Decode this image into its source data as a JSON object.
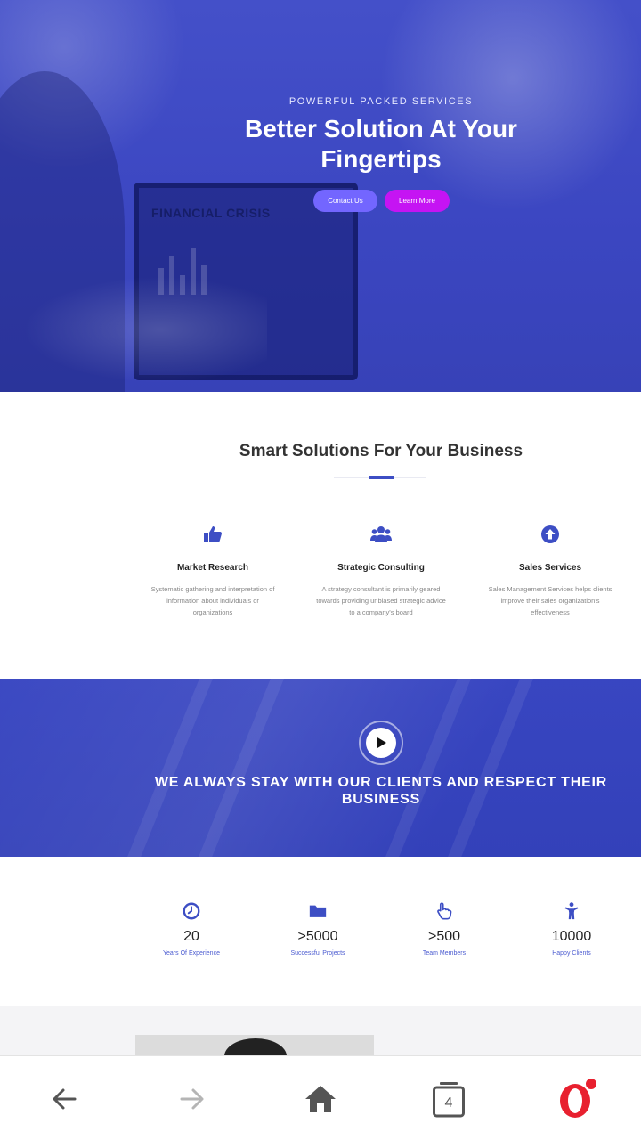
{
  "hero": {
    "eyebrow": "POWERFUL PACKED SERVICES",
    "title": "Better Solution At Your Fingertips",
    "background_text": "FINANCIAL CRISIS",
    "contact_button": "Contact Us",
    "learn_button": "Learn More"
  },
  "solutions": {
    "title": "Smart Solutions For Your Business",
    "items": [
      {
        "icon": "thumbs-up-icon",
        "name": "Market Research",
        "desc": "Systematic gathering and interpretation of information about individuals or organizations"
      },
      {
        "icon": "users-icon",
        "name": "Strategic Consulting",
        "desc": "A strategy consultant is primarily geared towards providing unbiased strategic advice to a company's board"
      },
      {
        "icon": "arrow-up-circle-icon",
        "name": "Sales Services",
        "desc": "Sales Management Services helps clients improve their sales organization's effectiveness"
      }
    ]
  },
  "banner": {
    "text": "WE ALWAYS STAY WITH OUR CLIENTS AND RESPECT THEIR BUSINESS"
  },
  "stats": [
    {
      "icon": "clock-icon",
      "value": "20",
      "label": "Years Of Experience"
    },
    {
      "icon": "folder-icon",
      "value": ">5000",
      "label": "Successful Projects"
    },
    {
      "icon": "pointer-hand-icon",
      "value": ">500",
      "label": "Team Members"
    },
    {
      "icon": "person-icon",
      "value": "10000",
      "label": "Happy Clients"
    }
  ],
  "browser": {
    "tab_count": "4"
  },
  "colors": {
    "primary": "#3d4ec4",
    "contact_button": "#7366ff",
    "learn_button": "#c514f3",
    "notification_dot": "#e8202f"
  }
}
